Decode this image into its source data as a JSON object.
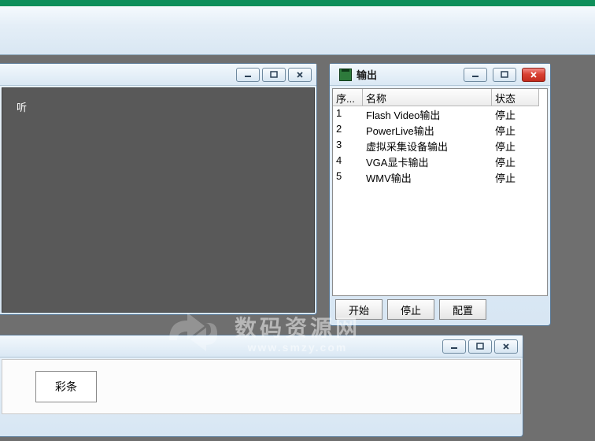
{
  "panel1": {
    "snippet_text": "听"
  },
  "panel2": {
    "title": "输出",
    "columns": {
      "idx": "序...",
      "name": "名称",
      "status": "状态"
    },
    "rows": [
      {
        "idx": "1",
        "name": "Flash Video输出",
        "status": "停止"
      },
      {
        "idx": "2",
        "name": "PowerLive输出",
        "status": "停止"
      },
      {
        "idx": "3",
        "name": "虚拟采集设备输出",
        "status": "停止"
      },
      {
        "idx": "4",
        "name": "VGA显卡输出",
        "status": "停止"
      },
      {
        "idx": "5",
        "name": "WMV输出",
        "status": "停止"
      }
    ],
    "buttons": {
      "start": "开始",
      "stop": "停止",
      "config": "配置"
    }
  },
  "panel3": {
    "button": "彩条"
  },
  "watermark": {
    "line1": "数码资源网",
    "line2": "www.smzy.com"
  }
}
